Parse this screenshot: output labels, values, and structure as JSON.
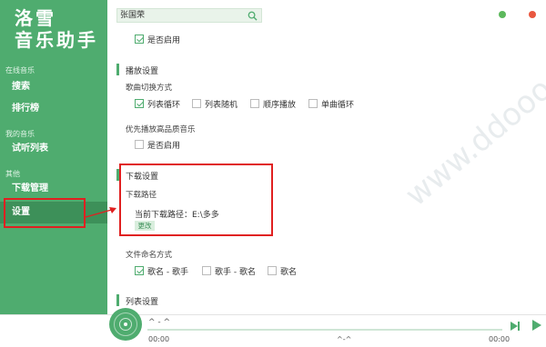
{
  "app": {
    "logo_line1": "洛雪",
    "logo_line2": "音乐助手"
  },
  "sidebar": {
    "sections": [
      {
        "title": "在线音乐",
        "items": [
          "搜索",
          "排行榜"
        ]
      },
      {
        "title": "我的音乐",
        "items": [
          "试听列表"
        ]
      },
      {
        "title": "其他",
        "items": [
          "下载管理",
          "设置"
        ]
      }
    ],
    "active_item": "设置"
  },
  "search": {
    "value": "张国荣",
    "icon": "search-icon"
  },
  "window_controls": {
    "minimize_color": "#5cb85c",
    "close_color": "#e9573f"
  },
  "settings": {
    "top_checkbox": {
      "label": "是否启用",
      "checked": true
    },
    "playback": {
      "title": "播放设置",
      "switch_mode_label": "歌曲切换方式",
      "switch_modes": [
        {
          "label": "列表循环",
          "checked": true
        },
        {
          "label": "列表随机",
          "checked": false
        },
        {
          "label": "顺序播放",
          "checked": false
        },
        {
          "label": "单曲循环",
          "checked": false
        }
      ],
      "hq_label": "优先播放高品质音乐",
      "hq_checkbox": {
        "label": "是否启用",
        "checked": false
      }
    },
    "download": {
      "title": "下载设置",
      "path_label": "下载路径",
      "current_path": "当前下载路径：E:\\多多",
      "change_button": "更改"
    },
    "naming": {
      "label": "文件命名方式",
      "options": [
        {
          "label": "歌名 - 歌手",
          "checked": true
        },
        {
          "label": "歌手 - 歌名",
          "checked": false
        },
        {
          "label": "歌名",
          "checked": false
        }
      ]
    },
    "list": {
      "title": "列表设置"
    }
  },
  "player": {
    "title": "^ - ^",
    "time_current": "00:00",
    "time_total": "00:00",
    "center_text": "^-^",
    "accent": "#4fac6f"
  },
  "watermark": "www.ddooo.com"
}
